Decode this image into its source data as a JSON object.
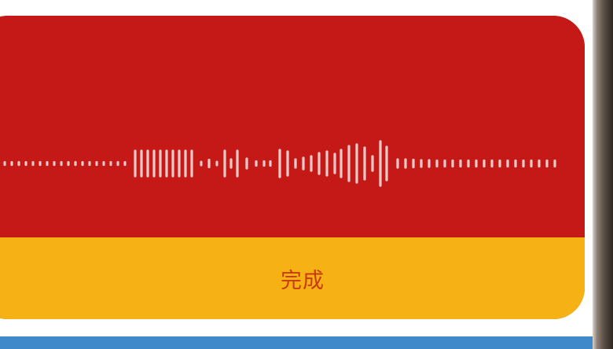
{
  "card": {
    "done_label": "完成"
  },
  "waveform": {
    "color": "#f2d4d2",
    "bars": [
      0.05,
      0.05,
      0.05,
      0.05,
      0.05,
      0.05,
      0.05,
      0.05,
      0.05,
      0.05,
      0.05,
      0.05,
      0.05,
      0.05,
      0.05,
      0.05,
      0.05,
      0.05,
      0.05,
      0.05,
      0.05,
      0.05,
      0.05,
      0.05,
      0.05,
      0.05,
      0.05,
      0.05,
      0.05,
      0.05,
      0.05,
      0.05,
      0.05,
      0.05,
      0.05,
      0.05,
      0.05,
      0.05,
      0.05,
      0.05,
      0.05,
      0.05,
      0.05,
      0.05,
      0.05,
      0.05,
      0.05,
      0.05,
      0.05,
      0.05,
      0.05,
      0.05,
      0.05,
      0.05,
      0.05,
      0.05,
      0.05,
      0.05,
      0.05,
      0.05,
      0.05,
      0.05,
      0.05,
      0.05,
      0.05,
      0.05,
      0.05,
      0.05,
      0.05,
      0.05,
      0.05,
      0.05,
      0.05,
      0.05,
      0.05,
      0.05,
      0.05,
      0.05,
      0.05,
      0.05,
      0.05,
      0.05,
      0.05,
      0.05,
      0.05,
      0.05,
      0.05,
      0.05,
      0.05,
      0.05,
      0.05,
      0.05,
      0.05,
      0.05,
      0.05,
      0.05,
      0.05,
      0.05,
      0.05,
      0.05,
      0.05,
      0.05,
      0.05,
      0.05,
      0.05,
      0.05,
      0.05,
      0.05,
      0.05,
      0.05,
      0.05,
      0.05,
      0.05,
      0.05,
      0.05,
      0.05,
      0.05,
      0.05,
      0.05,
      0.05,
      0.05,
      0.05,
      0.05,
      0.05,
      0.05,
      0.05,
      0.05,
      0.05,
      0.05,
      0.05
    ]
  }
}
